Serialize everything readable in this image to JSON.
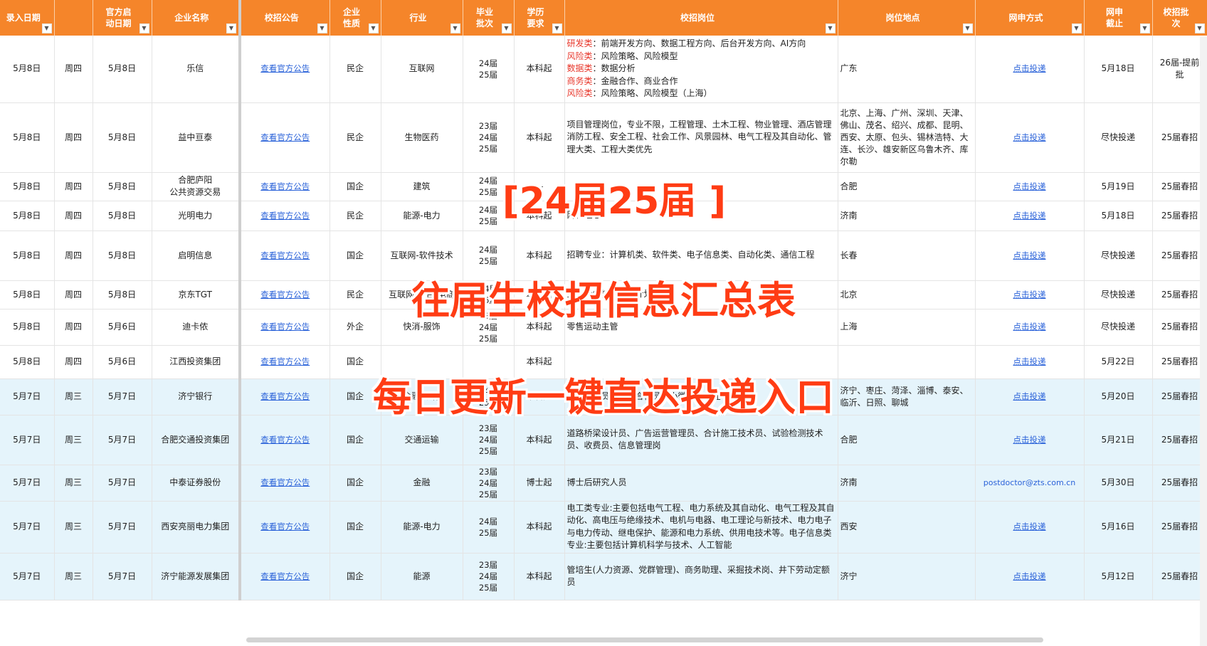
{
  "columns": [
    {
      "key": "entry_date",
      "label": "录入日期"
    },
    {
      "key": "weekday",
      "label": ""
    },
    {
      "key": "official_date",
      "label": "官方启\n动日期"
    },
    {
      "key": "company",
      "label": "企业名称"
    },
    {
      "key": "notice",
      "label": "校招公告"
    },
    {
      "key": "nature",
      "label": "企业\n性质"
    },
    {
      "key": "industry",
      "label": "行业"
    },
    {
      "key": "batch",
      "label": "毕业\n批次"
    },
    {
      "key": "education",
      "label": "学历\n要求"
    },
    {
      "key": "positions",
      "label": "校招岗位"
    },
    {
      "key": "location",
      "label": "岗位地点"
    },
    {
      "key": "apply",
      "label": "网申方式"
    },
    {
      "key": "deadline",
      "label": "网申\n截止"
    },
    {
      "key": "round",
      "label": "校招批\n次"
    }
  ],
  "rows": [
    {
      "entry_date": "5月8日",
      "weekday": "周四",
      "official_date": "5月8日",
      "company": "乐信",
      "notice": "查看官方公告",
      "nature": "民企",
      "industry": "互联网",
      "batch": "24届\n25届",
      "education": "本科起",
      "positions": [
        [
          "研发类",
          "：前端开发方向、数据工程方向、后台开发方向、AI方向"
        ],
        [
          "风险类",
          "：风险策略、风险模型"
        ],
        [
          "数据类",
          "：数据分析"
        ],
        [
          "商务类",
          "：金融合作、商业合作"
        ],
        [
          "风险类",
          "：风险策略、风险模型（上海）"
        ]
      ],
      "location": "广东",
      "apply": "点击投递",
      "deadline": "5月18日",
      "round": "26届-提前\n批",
      "blue": false
    },
    {
      "entry_date": "5月8日",
      "weekday": "周四",
      "official_date": "5月8日",
      "company": "益中亘泰",
      "notice": "查看官方公告",
      "nature": "民企",
      "industry": "生物医药",
      "batch": "23届\n24届\n25届",
      "education": "本科起",
      "positions": [
        [
          "",
          "项目管理岗位，专业不限，工程管理、土木工程、物业管理、酒店管理"
        ],
        [
          "",
          "消防工程、安全工程、社会工作、风景园林、电气工程及其自动化、管理大类、工程大类优先"
        ]
      ],
      "location": "北京、上海、广州、深圳、天津、佛山、茂名、绍兴、成都、昆明、西安、太原、包头、锡林浩特、大连、长沙、雄安新区乌鲁木齐、库尔勒",
      "apply": "点击投递",
      "deadline": "尽快投递",
      "round": "25届春招",
      "blue": false
    },
    {
      "entry_date": "5月8日",
      "weekday": "周四",
      "official_date": "5月8日",
      "company": "合肥庐阳\n公共资源交易",
      "notice": "查看官方公告",
      "nature": "国企",
      "industry": "建筑",
      "batch": "24届\n25届",
      "education": "—",
      "positions": [
        [
          "",
          ""
        ]
      ],
      "location": "合肥",
      "apply": "点击投递",
      "deadline": "5月19日",
      "round": "25届春招",
      "blue": false
    },
    {
      "entry_date": "5月8日",
      "weekday": "周四",
      "official_date": "5月8日",
      "company": "光明电力",
      "notice": "查看官方公告",
      "nature": "民企",
      "industry": "能源-电力",
      "batch": "24届\n25届",
      "education": "本科起",
      "positions": [
        [
          "",
          "网格经理"
        ]
      ],
      "location": "济南",
      "apply": "点击投递",
      "deadline": "5月18日",
      "round": "25届春招",
      "blue": false
    },
    {
      "entry_date": "5月8日",
      "weekday": "周四",
      "official_date": "5月8日",
      "company": "启明信息",
      "notice": "查看官方公告",
      "nature": "国企",
      "industry": "互联网-软件技术",
      "batch": "24届\n25届",
      "education": "本科起",
      "positions": [
        [
          "",
          "招聘专业：计算机类、软件类、电子信息类、自动化类、通信工程"
        ]
      ],
      "location": "长春",
      "apply": "点击投递",
      "deadline": "尽快投递",
      "round": "25届春招",
      "blue": false
    },
    {
      "entry_date": "5月8日",
      "weekday": "周四",
      "official_date": "5月8日",
      "company": "京东TGT",
      "notice": "查看官方公告",
      "nature": "民企",
      "industry": "互联网-平台-电商",
      "batch": "24届\n25届",
      "education": "本科起",
      "positions": [
        [
          "",
          "顶尖青年技术天才计划"
        ]
      ],
      "location": "北京",
      "apply": "点击投递",
      "deadline": "尽快投递",
      "round": "25届春招",
      "blue": false
    },
    {
      "entry_date": "5月8日",
      "weekday": "周四",
      "official_date": "5月6日",
      "company": "迪卡侬",
      "notice": "查看官方公告",
      "nature": "外企",
      "industry": "快消-服饰",
      "batch": "23届\n24届\n25届",
      "education": "本科起",
      "positions": [
        [
          "",
          "零售运动主管"
        ]
      ],
      "location": "上海",
      "apply": "点击投递",
      "deadline": "尽快投递",
      "round": "25届春招",
      "blue": false
    },
    {
      "entry_date": "5月8日",
      "weekday": "周四",
      "official_date": "5月6日",
      "company": "江西投资集团",
      "notice": "查看官方公告",
      "nature": "国企",
      "industry": "",
      "batch": "",
      "education": "本科起",
      "positions": [
        [
          "",
          ""
        ]
      ],
      "location": "",
      "apply": "点击投递",
      "deadline": "5月22日",
      "round": "25届春招",
      "blue": false
    },
    {
      "entry_date": "5月7日",
      "weekday": "周三",
      "official_date": "5月7日",
      "company": "济宁银行",
      "notice": "查看官方公告",
      "nature": "国企",
      "industry": "金融-银行",
      "batch": "24届\n25届",
      "education": "本科起",
      "positions": [
        [
          "",
          "总行部室员工、综合柜员、小微客户经理"
        ]
      ],
      "location": "济宁、枣庄、菏泽、淄博、泰安、临沂、日照、聊城",
      "apply": "点击投递",
      "deadline": "5月20日",
      "round": "25届春招",
      "blue": true
    },
    {
      "entry_date": "5月7日",
      "weekday": "周三",
      "official_date": "5月7日",
      "company": "合肥交通投资集团",
      "notice": "查看官方公告",
      "nature": "国企",
      "industry": "交通运输",
      "batch": "23届\n24届\n25届",
      "education": "本科起",
      "positions": [
        [
          "",
          "道路桥梁设计员、广告运营管理员、合计施工技术员、试验检测技术员、收费员、信息管理岗"
        ]
      ],
      "location": "合肥",
      "apply": "点击投递",
      "deadline": "5月21日",
      "round": "25届春招",
      "blue": true
    },
    {
      "entry_date": "5月7日",
      "weekday": "周三",
      "official_date": "5月7日",
      "company": "中泰证券股份",
      "notice": "查看官方公告",
      "nature": "国企",
      "industry": "金融",
      "batch": "23届\n24届\n25届",
      "education": "博士起",
      "positions": [
        [
          "",
          "博士后研究人员"
        ]
      ],
      "location": "济南",
      "apply": "postdoctor@zts.com.cn",
      "deadline": "5月30日",
      "round": "25届春招",
      "blue": true
    },
    {
      "entry_date": "5月7日",
      "weekday": "周三",
      "official_date": "5月7日",
      "company": "西安亮丽电力集团",
      "notice": "查看官方公告",
      "nature": "国企",
      "industry": "能源-电力",
      "batch": "24届\n25届",
      "education": "本科起",
      "positions": [
        [
          "",
          "电工类专业:主要包括电气工程、电力系统及其自动化、电气工程及其自动化、高电压与绝缘技术、电机与电器、电工理论与新技术、电力电子与电力传动、继电保护、能源和电力系统、供用电技术等。电子信息类专业:主要包括计算机科学与技术、人工智能"
        ]
      ],
      "location": "西安",
      "apply": "点击投递",
      "deadline": "5月16日",
      "round": "25届春招",
      "blue": true
    },
    {
      "entry_date": "5月7日",
      "weekday": "周三",
      "official_date": "5月7日",
      "company": "济宁能源发展集团",
      "notice": "查看官方公告",
      "nature": "国企",
      "industry": "能源",
      "batch": "23届\n24届\n25届",
      "education": "本科起",
      "positions": [
        [
          "",
          "管培生(人力资源、党群管理)、商务助理、采掘技术岗、井下劳动定额员"
        ]
      ],
      "location": "济宁",
      "apply": "点击投递",
      "deadline": "5月12日",
      "round": "25届春招",
      "blue": true
    }
  ],
  "overlay": {
    "line1": "[24届25届 ]",
    "line2": "往届生校招信息汇总表",
    "line3": "每日更新一键直达投递入口"
  },
  "colors": {
    "header": "#f5852a",
    "link": "#2a62d9",
    "highlight": "#e8372b",
    "overlay": "#ff3c14",
    "row_blue": "#e5f4fb"
  }
}
